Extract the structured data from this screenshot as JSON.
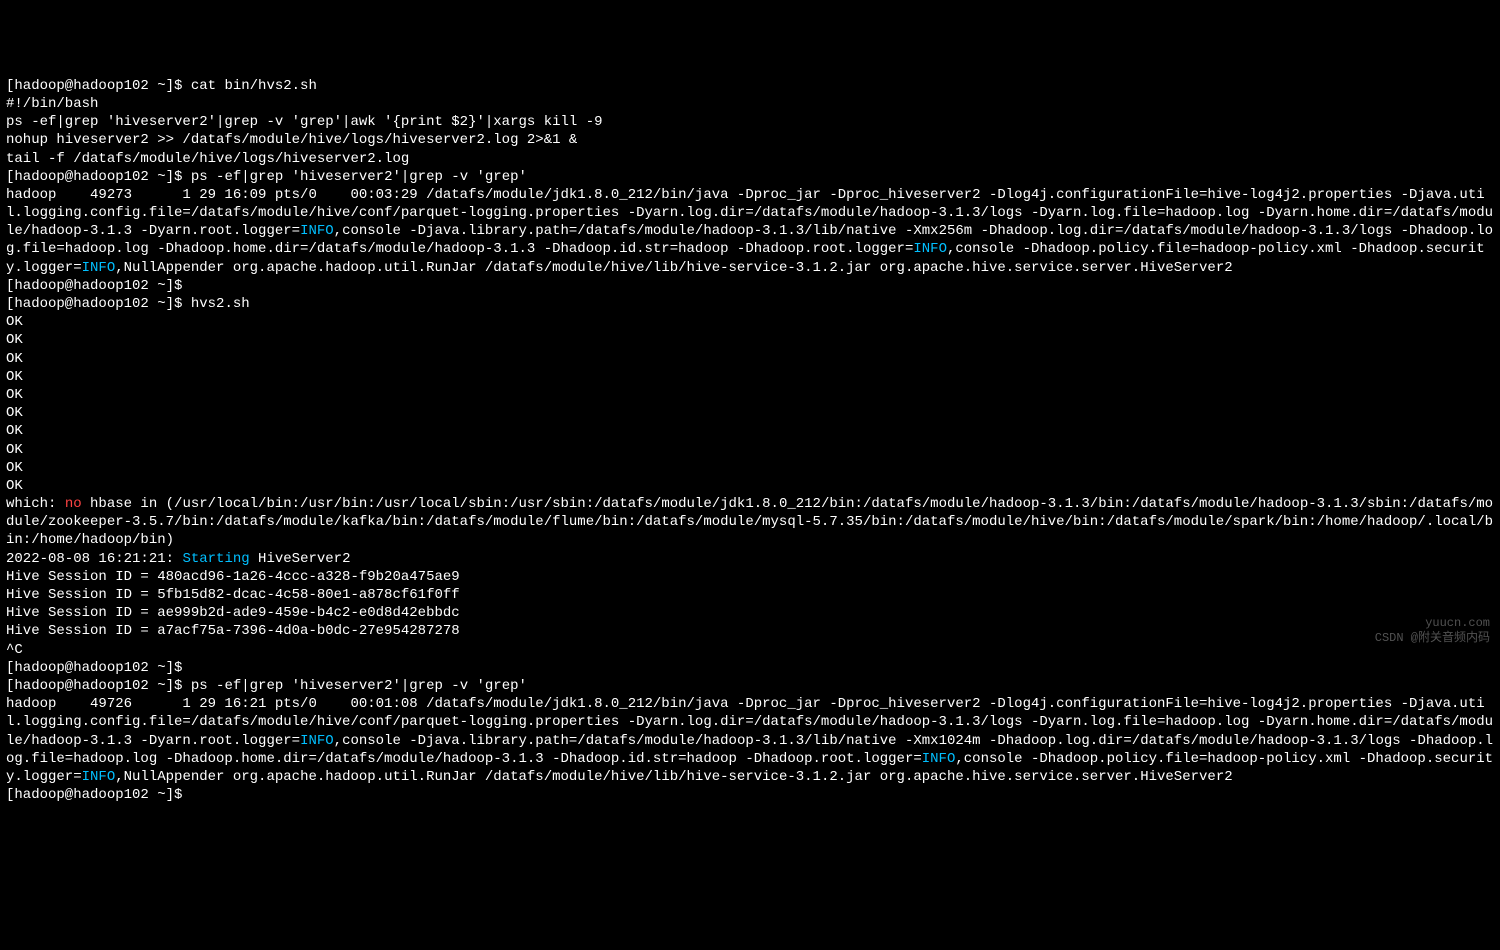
{
  "terminal": {
    "prompt1": "[hadoop@hadoop102 ~]$ ",
    "cmd1": "cat bin/hvs2.sh",
    "shebang": "#!/bin/bash",
    "blank": "",
    "script1": "ps -ef|grep 'hiveserver2'|grep -v 'grep'|awk '{print $2}'|xargs kill -9",
    "script2": "nohup hiveserver2 >> /datafs/module/hive/logs/hiveserver2.log 2>&1 &",
    "script3": "tail -f /datafs/module/hive/logs/hiveserver2.log",
    "prompt2": "[hadoop@hadoop102 ~]$ ",
    "cmd2": "ps -ef|grep 'hiveserver2'|grep -v 'grep'",
    "ps1_p1": "hadoop    49273      1 29 16:09 pts/0    00:03:29 /datafs/module/jdk1.8.0_212/bin/java -Dproc_jar -Dproc_hiveserver2 -Dlog4j.configurationFile=hive-log4j2.properties -Djava.util.logging.config.file=/datafs/module/hive/conf/parquet-logging.properties -Dyarn.log.dir=/datafs/module/hadoop-3.1.3/logs -Dyarn.log.file=hadoop.log -Dyarn.home.dir=/datafs/module/hadoop-3.1.3 -Dyarn.root.logger=",
    "ps1_info1": "INFO",
    "ps1_p2": ",console -Djava.library.path=/datafs/module/hadoop-3.1.3/lib/native -Xmx256m -Dhadoop.log.dir=/datafs/module/hadoop-3.1.3/logs -Dhadoop.log.file=hadoop.log -Dhadoop.home.dir=/datafs/module/hadoop-3.1.3 -Dhadoop.id.str=hadoop -Dhadoop.root.logger=",
    "ps1_info2": "INFO",
    "ps1_p3": ",console -Dhadoop.policy.file=hadoop-policy.xml -Dhadoop.security.logger=",
    "ps1_info3": "INFO",
    "ps1_p4": ",NullAppender org.apache.hadoop.util.RunJar /datafs/module/hive/lib/hive-service-3.1.2.jar org.apache.hive.service.server.HiveServer2",
    "prompt3": "[hadoop@hadoop102 ~]$ ",
    "prompt4": "[hadoop@hadoop102 ~]$ ",
    "cmd4": "hvs2.sh",
    "ok": "OK",
    "which_p1": "which: ",
    "which_no": "no",
    "which_p2": " hbase in (/usr/local/bin:/usr/bin:/usr/local/sbin:/usr/sbin:/datafs/module/jdk1.8.0_212/bin:/datafs/module/hadoop-3.1.3/bin:/datafs/module/hadoop-3.1.3/sbin:/datafs/module/zookeeper-3.5.7/bin:/datafs/module/kafka/bin:/datafs/module/flume/bin:/datafs/module/mysql-5.7.35/bin:/datafs/module/hive/bin:/datafs/module/spark/bin:/home/hadoop/.local/bin:/home/hadoop/bin)",
    "ts": "2022-08-08 16:21:21: ",
    "starting": "Starting",
    "hs2": " HiveServer2",
    "sess1": "Hive Session ID = 480acd96-1a26-4ccc-a328-f9b20a475ae9",
    "sess2": "Hive Session ID = 5fb15d82-dcac-4c58-80e1-a878cf61f0ff",
    "sess3": "Hive Session ID = ae999b2d-ade9-459e-b4c2-e0d8d42ebbdc",
    "sess4": "Hive Session ID = a7acf75a-7396-4d0a-b0dc-27e954287278",
    "ctrlc": "^C",
    "prompt5": "[hadoop@hadoop102 ~]$ ",
    "prompt6": "[hadoop@hadoop102 ~]$ ",
    "cmd6": "ps -ef|grep 'hiveserver2'|grep -v 'grep'",
    "ps2_p1": "hadoop    49726      1 29 16:21 pts/0    00:01:08 /datafs/module/jdk1.8.0_212/bin/java -Dproc_jar -Dproc_hiveserver2 -Dlog4j.configurationFile=hive-log4j2.properties -Djava.util.logging.config.file=/datafs/module/hive/conf/parquet-logging.properties -Dyarn.log.dir=/datafs/module/hadoop-3.1.3/logs -Dyarn.log.file=hadoop.log -Dyarn.home.dir=/datafs/module/hadoop-3.1.3 -Dyarn.root.logger=",
    "ps2_info1": "INFO",
    "ps2_p2": ",console -Djava.library.path=/datafs/module/hadoop-3.1.3/lib/native -Xmx1024m -Dhadoop.log.dir=/datafs/module/hadoop-3.1.3/logs -Dhadoop.log.file=hadoop.log -Dhadoop.home.dir=/datafs/module/hadoop-3.1.3 -Dhadoop.id.str=hadoop -Dhadoop.root.logger=",
    "ps2_info2": "INFO",
    "ps2_p3": ",console -Dhadoop.policy.file=hadoop-policy.xml -Dhadoop.security.logger=",
    "ps2_info3": "INFO",
    "ps2_p4": ",NullAppender org.apache.hadoop.util.RunJar /datafs/module/hive/lib/hive-service-3.1.2.jar org.apache.hive.service.server.HiveServer2",
    "prompt7": "[hadoop@hadoop102 ~]$",
    "watermark1": "yuucn.com",
    "watermark2": "CSDN @附关音频内码"
  }
}
